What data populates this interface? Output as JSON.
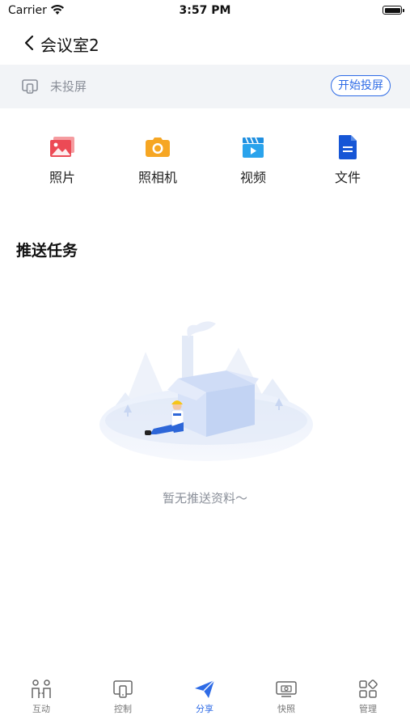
{
  "status_bar": {
    "carrier": "Carrier",
    "time": "3:57 PM"
  },
  "nav": {
    "title": "会议室2"
  },
  "projection": {
    "status": "未投屏",
    "button": "开始投屏"
  },
  "share_items": [
    {
      "label": "照片",
      "icon": "photo-icon"
    },
    {
      "label": "照相机",
      "icon": "camera-icon"
    },
    {
      "label": "视频",
      "icon": "video-icon"
    },
    {
      "label": "文件",
      "icon": "file-icon"
    }
  ],
  "section": {
    "title": "推送任务"
  },
  "empty": {
    "text": "暂无推送资料～"
  },
  "tabs": [
    {
      "label": "互动",
      "icon": "interaction-icon"
    },
    {
      "label": "控制",
      "icon": "control-icon"
    },
    {
      "label": "分享",
      "icon": "share-send-icon",
      "active": true
    },
    {
      "label": "快照",
      "icon": "snapshot-icon"
    },
    {
      "label": "管理",
      "icon": "manage-grid-icon"
    }
  ],
  "colors": {
    "accent": "#2e6be6",
    "muted": "#8a8f99",
    "bar_bg": "#f2f4f7"
  }
}
